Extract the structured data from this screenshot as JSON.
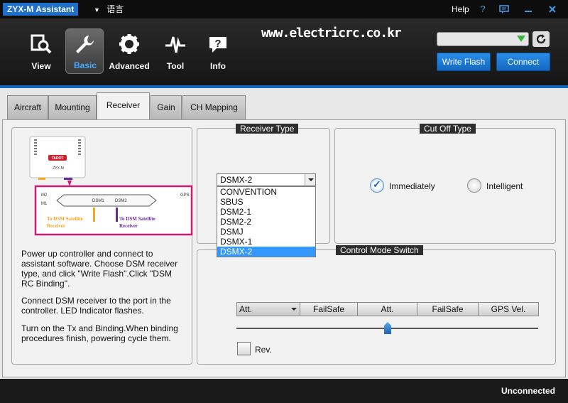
{
  "app": {
    "title": "ZYX-M Assistant",
    "language_label": "语言",
    "help_label": "Help",
    "help_icon": "?",
    "url_watermark": "www.electricrc.co.kr"
  },
  "nav": [
    {
      "label": "View",
      "icon": "magnifier-chart-icon"
    },
    {
      "label": "Basic",
      "icon": "wrench-icon",
      "active": true
    },
    {
      "label": "Advanced",
      "icon": "gear-icon"
    },
    {
      "label": "Tool",
      "icon": "waveform-icon"
    },
    {
      "label": "Info",
      "icon": "chat-question-icon"
    }
  ],
  "toolbar": {
    "port_value": "",
    "write_flash_label": "Write Flash",
    "connect_label": "Connect"
  },
  "tabs": [
    {
      "label": "Aircraft"
    },
    {
      "label": "Mounting"
    },
    {
      "label": "Receiver",
      "active": true
    },
    {
      "label": "Gain"
    },
    {
      "label": "CH Mapping"
    }
  ],
  "diagram": {
    "brand": "TAROT",
    "model": "ZYX-M",
    "m2": "M2",
    "m1": "M1",
    "gps": "GPS",
    "dsm1": "DSM1",
    "dsm2": "DSM2",
    "callout1": "To DSM Satellite Receiver",
    "callout1_line1": "To DSM Satellite",
    "callout1_line2": "Receiver",
    "callout2_line1": "To DSM Satellite",
    "callout2_line2": "Receiver"
  },
  "instructions": {
    "p1": "Power up controller and connect to assistant software. Choose DSM receiver type, and click \"Write Flash\".Click \"DSM RC Binding\".",
    "p2": "Connect DSM receiver to the port in the controller. LED Indicator flashes.",
    "p3": "Turn on the Tx and Binding.When binding procedures finish, powering cycle them."
  },
  "receiver_type": {
    "title": "Receiver Type",
    "selected": "DSMX-2",
    "options": [
      "CONVENTION",
      "SBUS",
      "DSM2-1",
      "DSM2-2",
      "DSMJ",
      "DSMX-1",
      "DSMX-2"
    ]
  },
  "cutoff": {
    "title": "Cut Off Type",
    "immediately": "Immediately",
    "intelligent": "Intelligent",
    "selected": "Immediately"
  },
  "control_mode": {
    "title": "Control Mode Switch",
    "mode_select": "Att.",
    "segments": [
      "FailSafe",
      "Att.",
      "FailSafe",
      "GPS Vel."
    ],
    "slider_position": 0.5,
    "rev_label": "Rev.",
    "rev_checked": false
  },
  "status": {
    "text": "Unconnected"
  },
  "colors": {
    "accent": "#1d6fc9",
    "diagram_frame": "#d01a73",
    "callout1": "#f5a623",
    "callout2": "#6a2a9a",
    "selection": "#3399ff"
  }
}
